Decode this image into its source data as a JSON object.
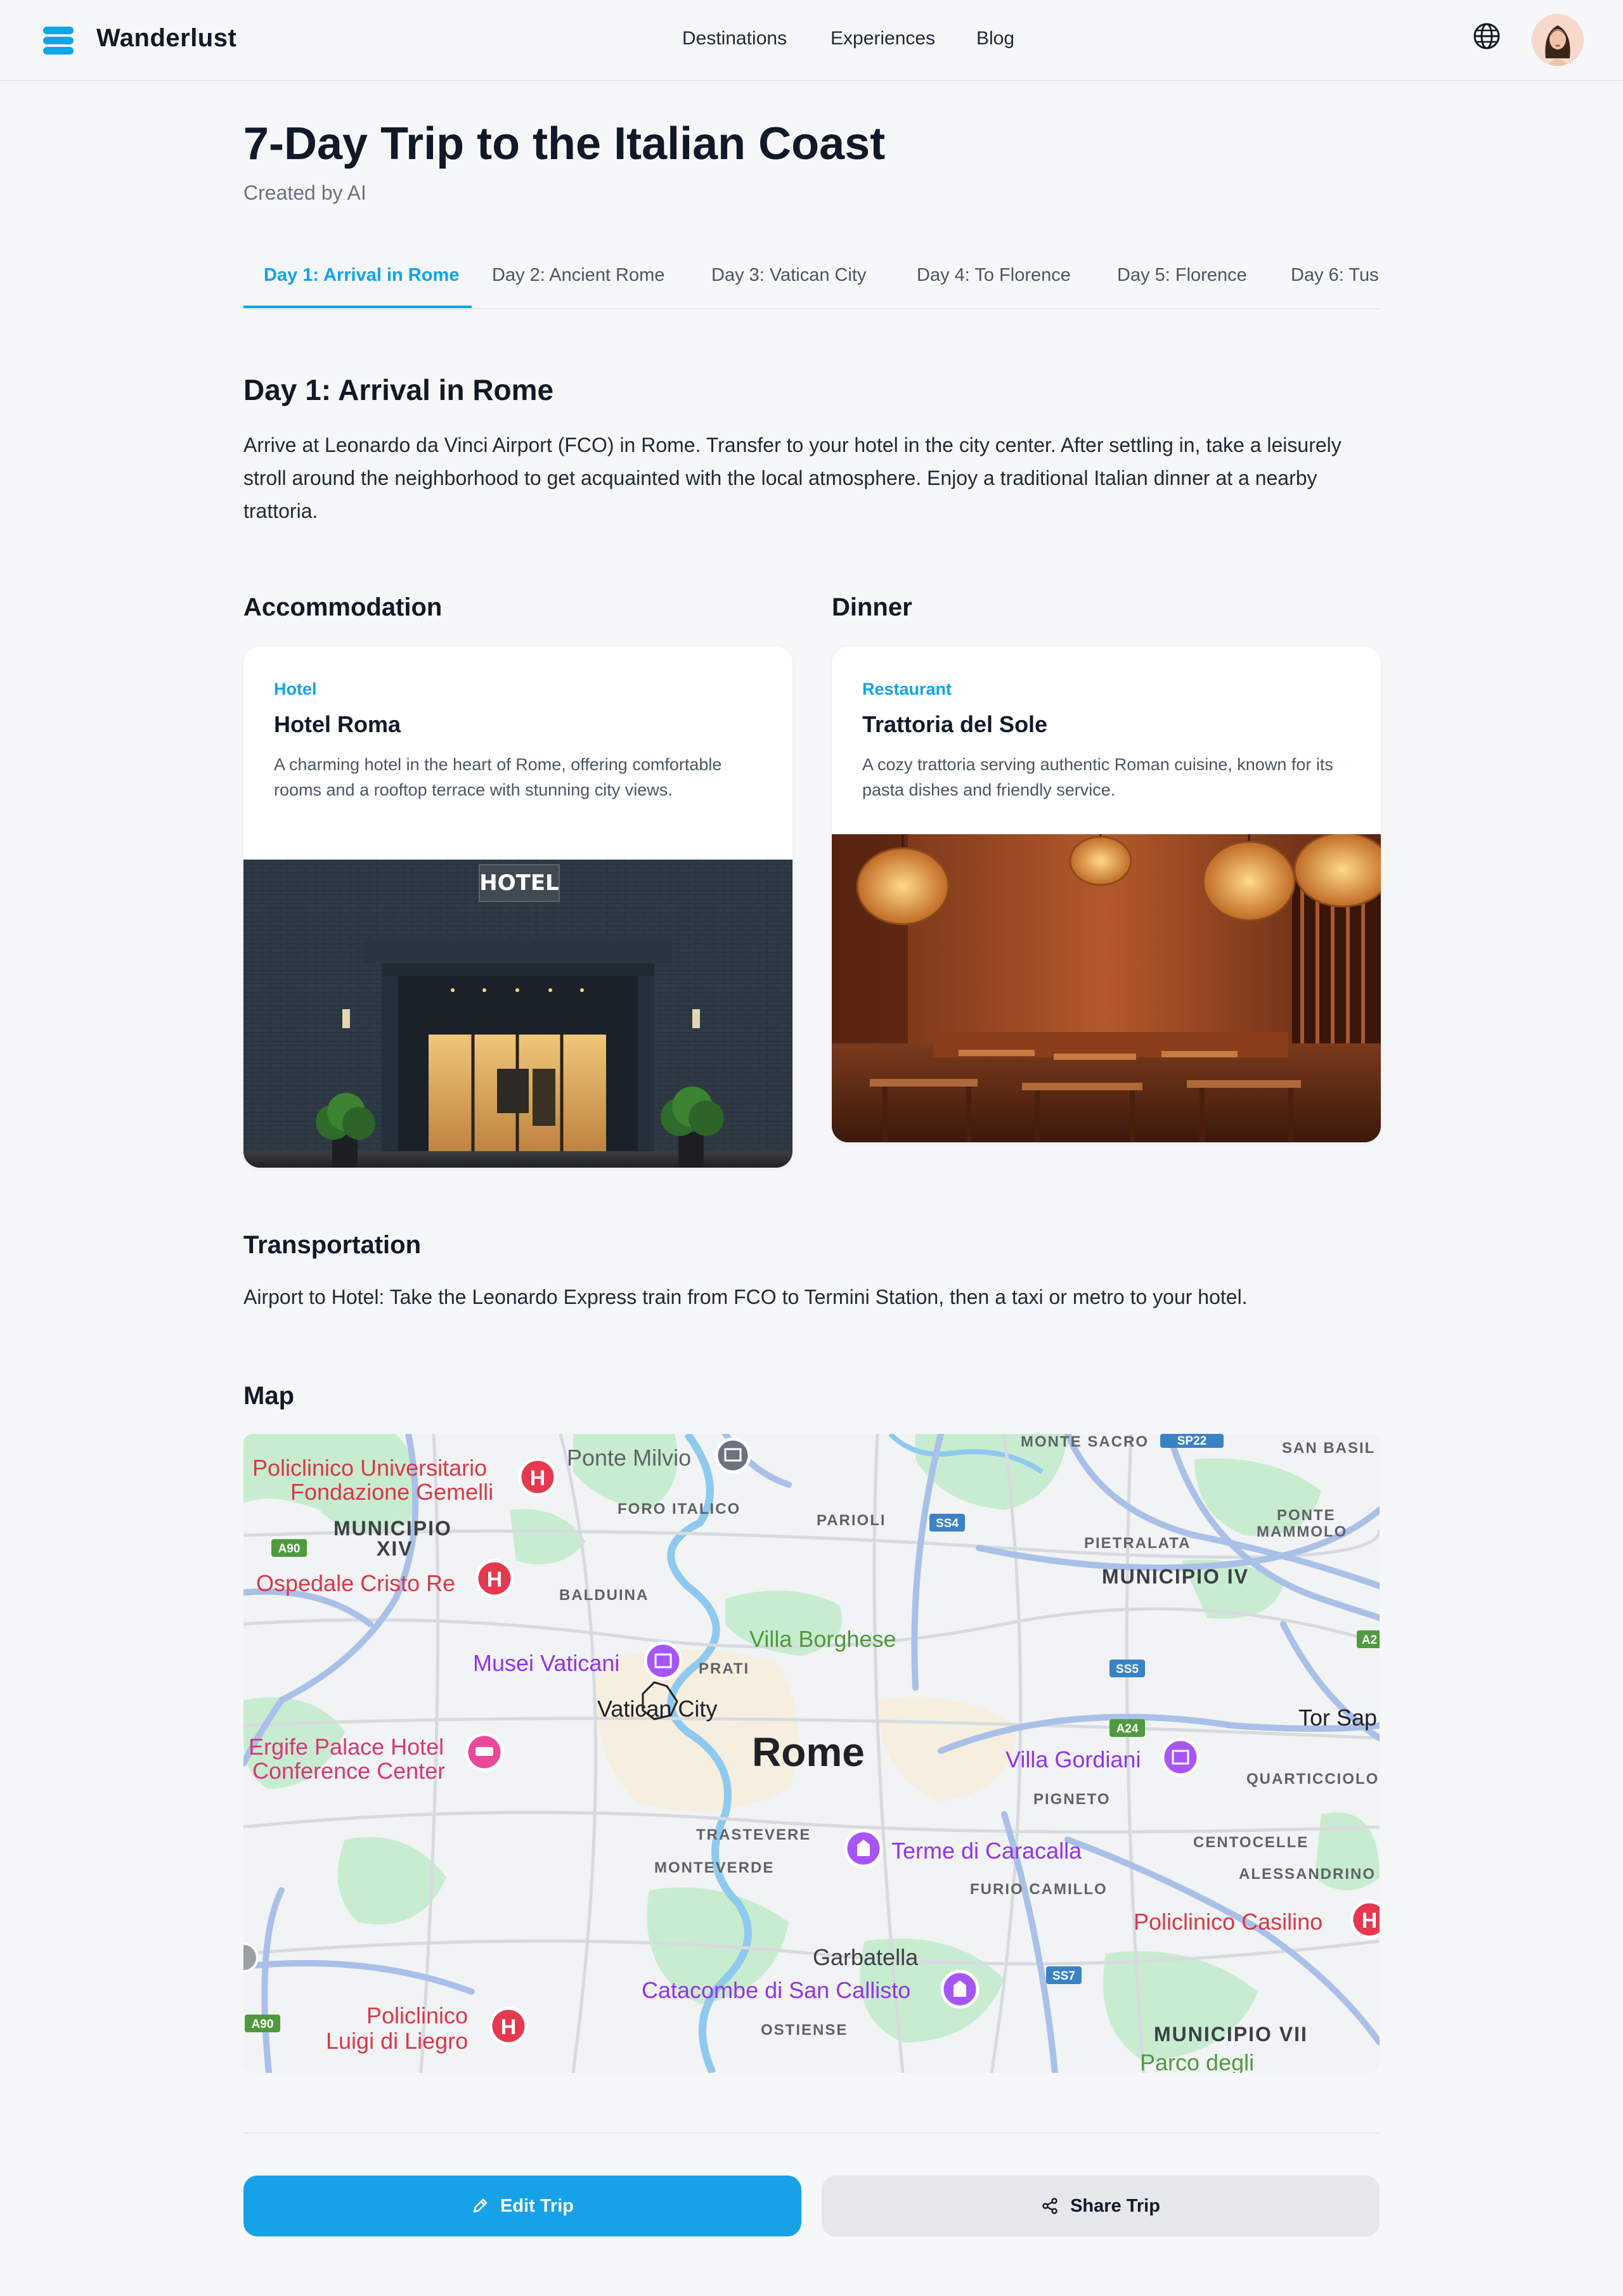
{
  "app": {
    "brand": "Wanderlust",
    "nav": [
      "Destinations",
      "Experiences",
      "Blog"
    ],
    "globe_icon": "globe-icon",
    "avatar_icon": "user-avatar"
  },
  "trip": {
    "title": "7-Day Trip to the Italian Coast",
    "subtitle": "Created by AI",
    "tabs": [
      "Day 1: Arrival in Rome",
      "Day 2: Ancient Rome",
      "Day 3: Vatican City",
      "Day 4: To Florence",
      "Day 5: Florence",
      "Day 6: Tus"
    ],
    "active_tab": 0
  },
  "day": {
    "title": "Day 1: Arrival in Rome",
    "description": "Arrive at Leonardo da Vinci Airport (FCO) in Rome. Transfer to your hotel in the city center. After settling in, take a leisurely stroll around the neighborhood to get acquainted with the local atmosphere. Enjoy a traditional Italian dinner at a nearby trattoria."
  },
  "accommodation": {
    "heading": "Accommodation",
    "type": "Hotel",
    "name": "Hotel Roma",
    "description": "A charming hotel in the heart of Rome, offering comfortable rooms and a rooftop terrace with stunning city views.",
    "sign_text": "HOTEL"
  },
  "dinner": {
    "heading": "Dinner",
    "type": "Restaurant",
    "name": "Trattoria del Sole",
    "description": "A cozy trattoria serving authentic Roman cuisine, known for its pasta dishes and friendly service."
  },
  "transportation": {
    "heading": "Transportation",
    "text": "Airport to Hotel: Take the Leonardo Express train from FCO to Termini Station, then a taxi or metro to your hotel."
  },
  "map": {
    "heading": "Map",
    "city": "Rome",
    "labels": {
      "policlinico_gemelli_1": "Policlinico Universitario",
      "policlinico_gemelli_2": "Fondazione Gemelli",
      "ponte_milvio": "Ponte Milvio",
      "foro_italico": "FORO ITALICO",
      "monte_sacro": "MONTE SACRO",
      "san_basilio": "SAN BASIL",
      "municipio_xiv_1": "MUNICIPIO",
      "municipio_xiv_2": "XIV",
      "parioli": "PARIOLI",
      "ponte_mammolo_1": "PONTE",
      "ponte_mammolo_2": "MAMMOLO",
      "pietralata": "PIETRALATA",
      "ospedale_cristo_re": "Ospedale Cristo Re",
      "balduina": "BALDUINA",
      "municipio_iv": "MUNICIPIO IV",
      "villa_borghese": "Villa Borghese",
      "musei_vaticani": "Musei Vaticani",
      "prati": "PRATI",
      "vatican_city": "Vatican City",
      "tor_sap": "Tor Sap",
      "ergife_1": "Ergife Palace Hotel",
      "ergife_2": "Conference Center",
      "villa_gordiani": "Villa Gordiani",
      "quarticciolo": "QUARTICCIOLO",
      "pigneto": "PIGNETO",
      "trastevere": "TRASTEVERE",
      "monteverde": "MONTEVERDE",
      "terme_caracalla": "Terme di Caracalla",
      "centocelle": "CENTOCELLE",
      "alessandrino": "ALESSANDRINO",
      "furio_camillo": "FURIO CAMILLO",
      "policlinico_casilino": "Policlinico Casilino",
      "garbatella": "Garbatella",
      "catacombe": "Catacombe di San Callisto",
      "policlinico_liegro_1": "Policlinico",
      "policlinico_liegro_2": "Luigi di Liegro",
      "ostiense": "OSTIENSE",
      "municipio_vii": "MUNICIPIO VII",
      "parco_degli": "Parco degli"
    },
    "shields": {
      "sp22": "SP22",
      "ss4": "SS4",
      "a90_a": "A90",
      "ss5": "SS5",
      "a24": "A24",
      "a2": "A2",
      "ss7": "SS7",
      "a90_b": "A90"
    }
  },
  "actions": {
    "edit_label": "Edit Trip",
    "share_label": "Share Trip"
  },
  "colors": {
    "accent": "#0ea5e9",
    "button_primary": "#17a2e8",
    "hospital": "#e53950",
    "attraction": "#a855f7"
  }
}
